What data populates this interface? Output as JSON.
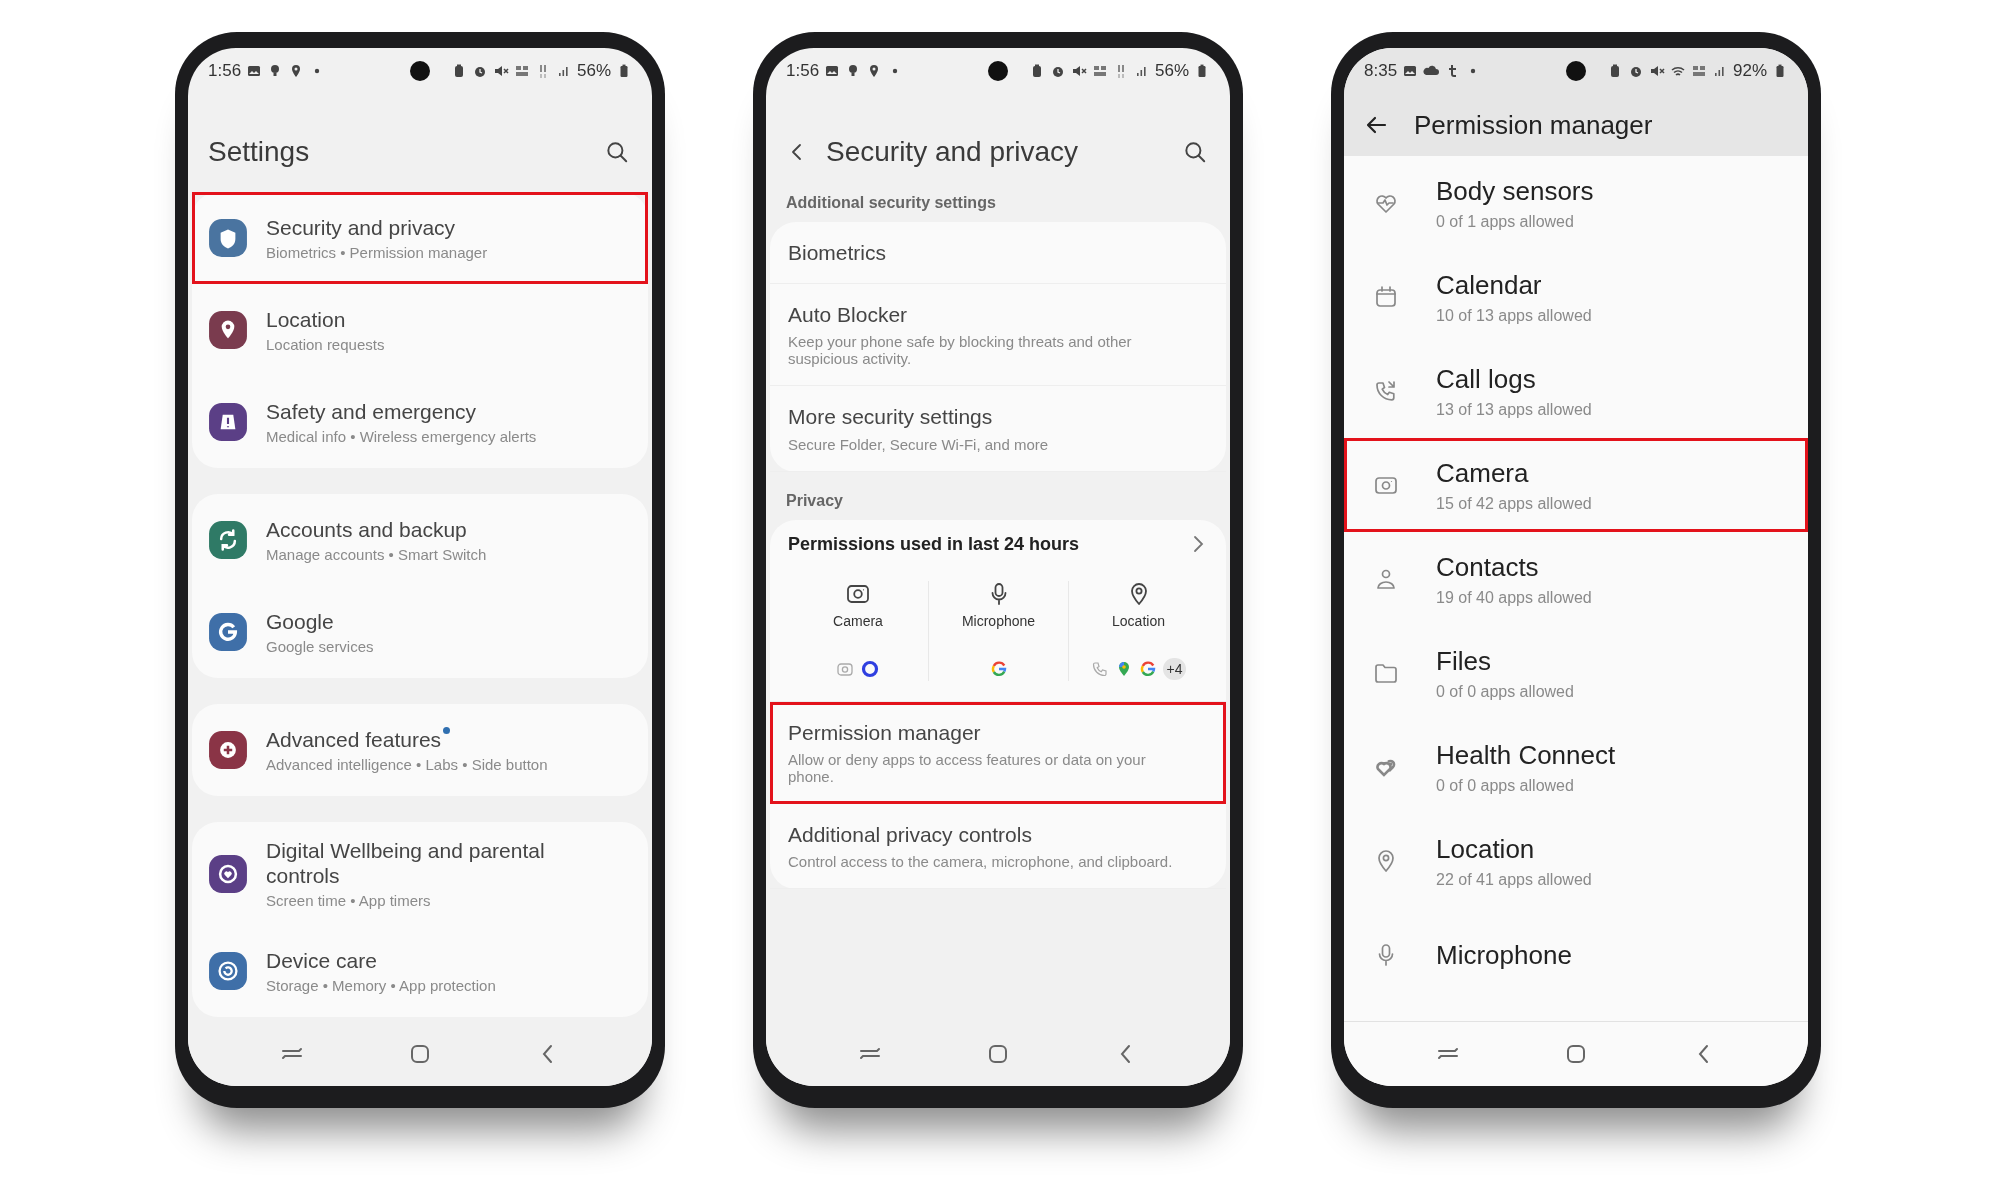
{
  "phones": [
    {
      "kind": "settings",
      "status_bar": {
        "time": "1:56",
        "battery": "56%"
      },
      "title": "Settings",
      "groups": [
        {
          "items": [
            {
              "title": "Security and privacy",
              "subtitle": "Biometrics • Permission manager",
              "color": "#4a74a0",
              "highlighted": true,
              "new_dot": false
            },
            {
              "title": "Location",
              "subtitle": "Location requests",
              "color": "#7a3b4e",
              "highlighted": false,
              "new_dot": false
            },
            {
              "title": "Safety and emergency",
              "subtitle": "Medical info • Wireless emergency alerts",
              "color": "#5b3f86",
              "highlighted": false,
              "new_dot": false
            }
          ]
        },
        {
          "items": [
            {
              "title": "Accounts and backup",
              "subtitle": "Manage accounts • Smart Switch",
              "color": "#2f7a66",
              "highlighted": false,
              "new_dot": false
            },
            {
              "title": "Google",
              "subtitle": "Google services",
              "color": "#3f6fa8",
              "highlighted": false,
              "new_dot": false
            }
          ]
        },
        {
          "items": [
            {
              "title": "Advanced features",
              "subtitle": "Advanced intelligence • Labs • Side button",
              "color": "#8a3446",
              "highlighted": false,
              "new_dot": true
            }
          ]
        },
        {
          "items": [
            {
              "title": "Digital Wellbeing and parental controls",
              "subtitle": "Screen time • App timers",
              "color": "#5b3f86",
              "highlighted": false,
              "new_dot": false
            },
            {
              "title": "Device care",
              "subtitle": "Storage • Memory • App protection",
              "color": "#3f6fa8",
              "highlighted": false,
              "new_dot": false
            }
          ]
        }
      ]
    },
    {
      "kind": "security",
      "status_bar": {
        "time": "1:56",
        "battery": "56%"
      },
      "title": "Security and privacy",
      "sections": [
        {
          "label": "Additional security settings",
          "items": [
            {
              "kind": "row",
              "title": "Biometrics",
              "highlighted": false
            },
            {
              "kind": "row",
              "title": "Auto Blocker",
              "subtitle": "Keep your phone safe by blocking threats and other suspicious activity.",
              "highlighted": false
            },
            {
              "kind": "row",
              "title": "More security settings",
              "subtitle": "Secure Folder, Secure Wi-Fi, and more",
              "highlighted": false
            }
          ]
        },
        {
          "label": "Privacy",
          "items": [
            {
              "kind": "permissions_used",
              "title": "Permissions used in last 24 hours",
              "highlighted": false,
              "columns": [
                {
                  "label": "Camera"
                },
                {
                  "label": "Microphone"
                },
                {
                  "label": "Location",
                  "extra": "+4"
                }
              ]
            },
            {
              "kind": "row",
              "title": "Permission manager",
              "subtitle": "Allow or deny apps to access features or data on your phone.",
              "highlighted": true
            },
            {
              "kind": "row",
              "title": "Additional privacy controls",
              "subtitle": "Control access to the camera, microphone, and clipboard.",
              "highlighted": false
            }
          ]
        }
      ]
    },
    {
      "kind": "permissions",
      "status_bar": {
        "time": "8:35",
        "battery": "92%"
      },
      "title": "Permission manager",
      "items": [
        {
          "title": "Body sensors",
          "subtitle": "0 of 1 apps allowed",
          "highlighted": false
        },
        {
          "title": "Calendar",
          "subtitle": "10 of 13 apps allowed",
          "highlighted": false
        },
        {
          "title": "Call logs",
          "subtitle": "13 of 13 apps allowed",
          "highlighted": false
        },
        {
          "title": "Camera",
          "subtitle": "15 of 42 apps allowed",
          "highlighted": true
        },
        {
          "title": "Contacts",
          "subtitle": "19 of 40 apps allowed",
          "highlighted": false
        },
        {
          "title": "Files",
          "subtitle": "0 of 0 apps allowed",
          "highlighted": false
        },
        {
          "title": "Health Connect",
          "subtitle": "0 of 0 apps allowed",
          "highlighted": false
        },
        {
          "title": "Location",
          "subtitle": "22 of 41 apps allowed",
          "highlighted": false
        },
        {
          "title": "Microphone",
          "highlighted": false
        }
      ]
    }
  ]
}
